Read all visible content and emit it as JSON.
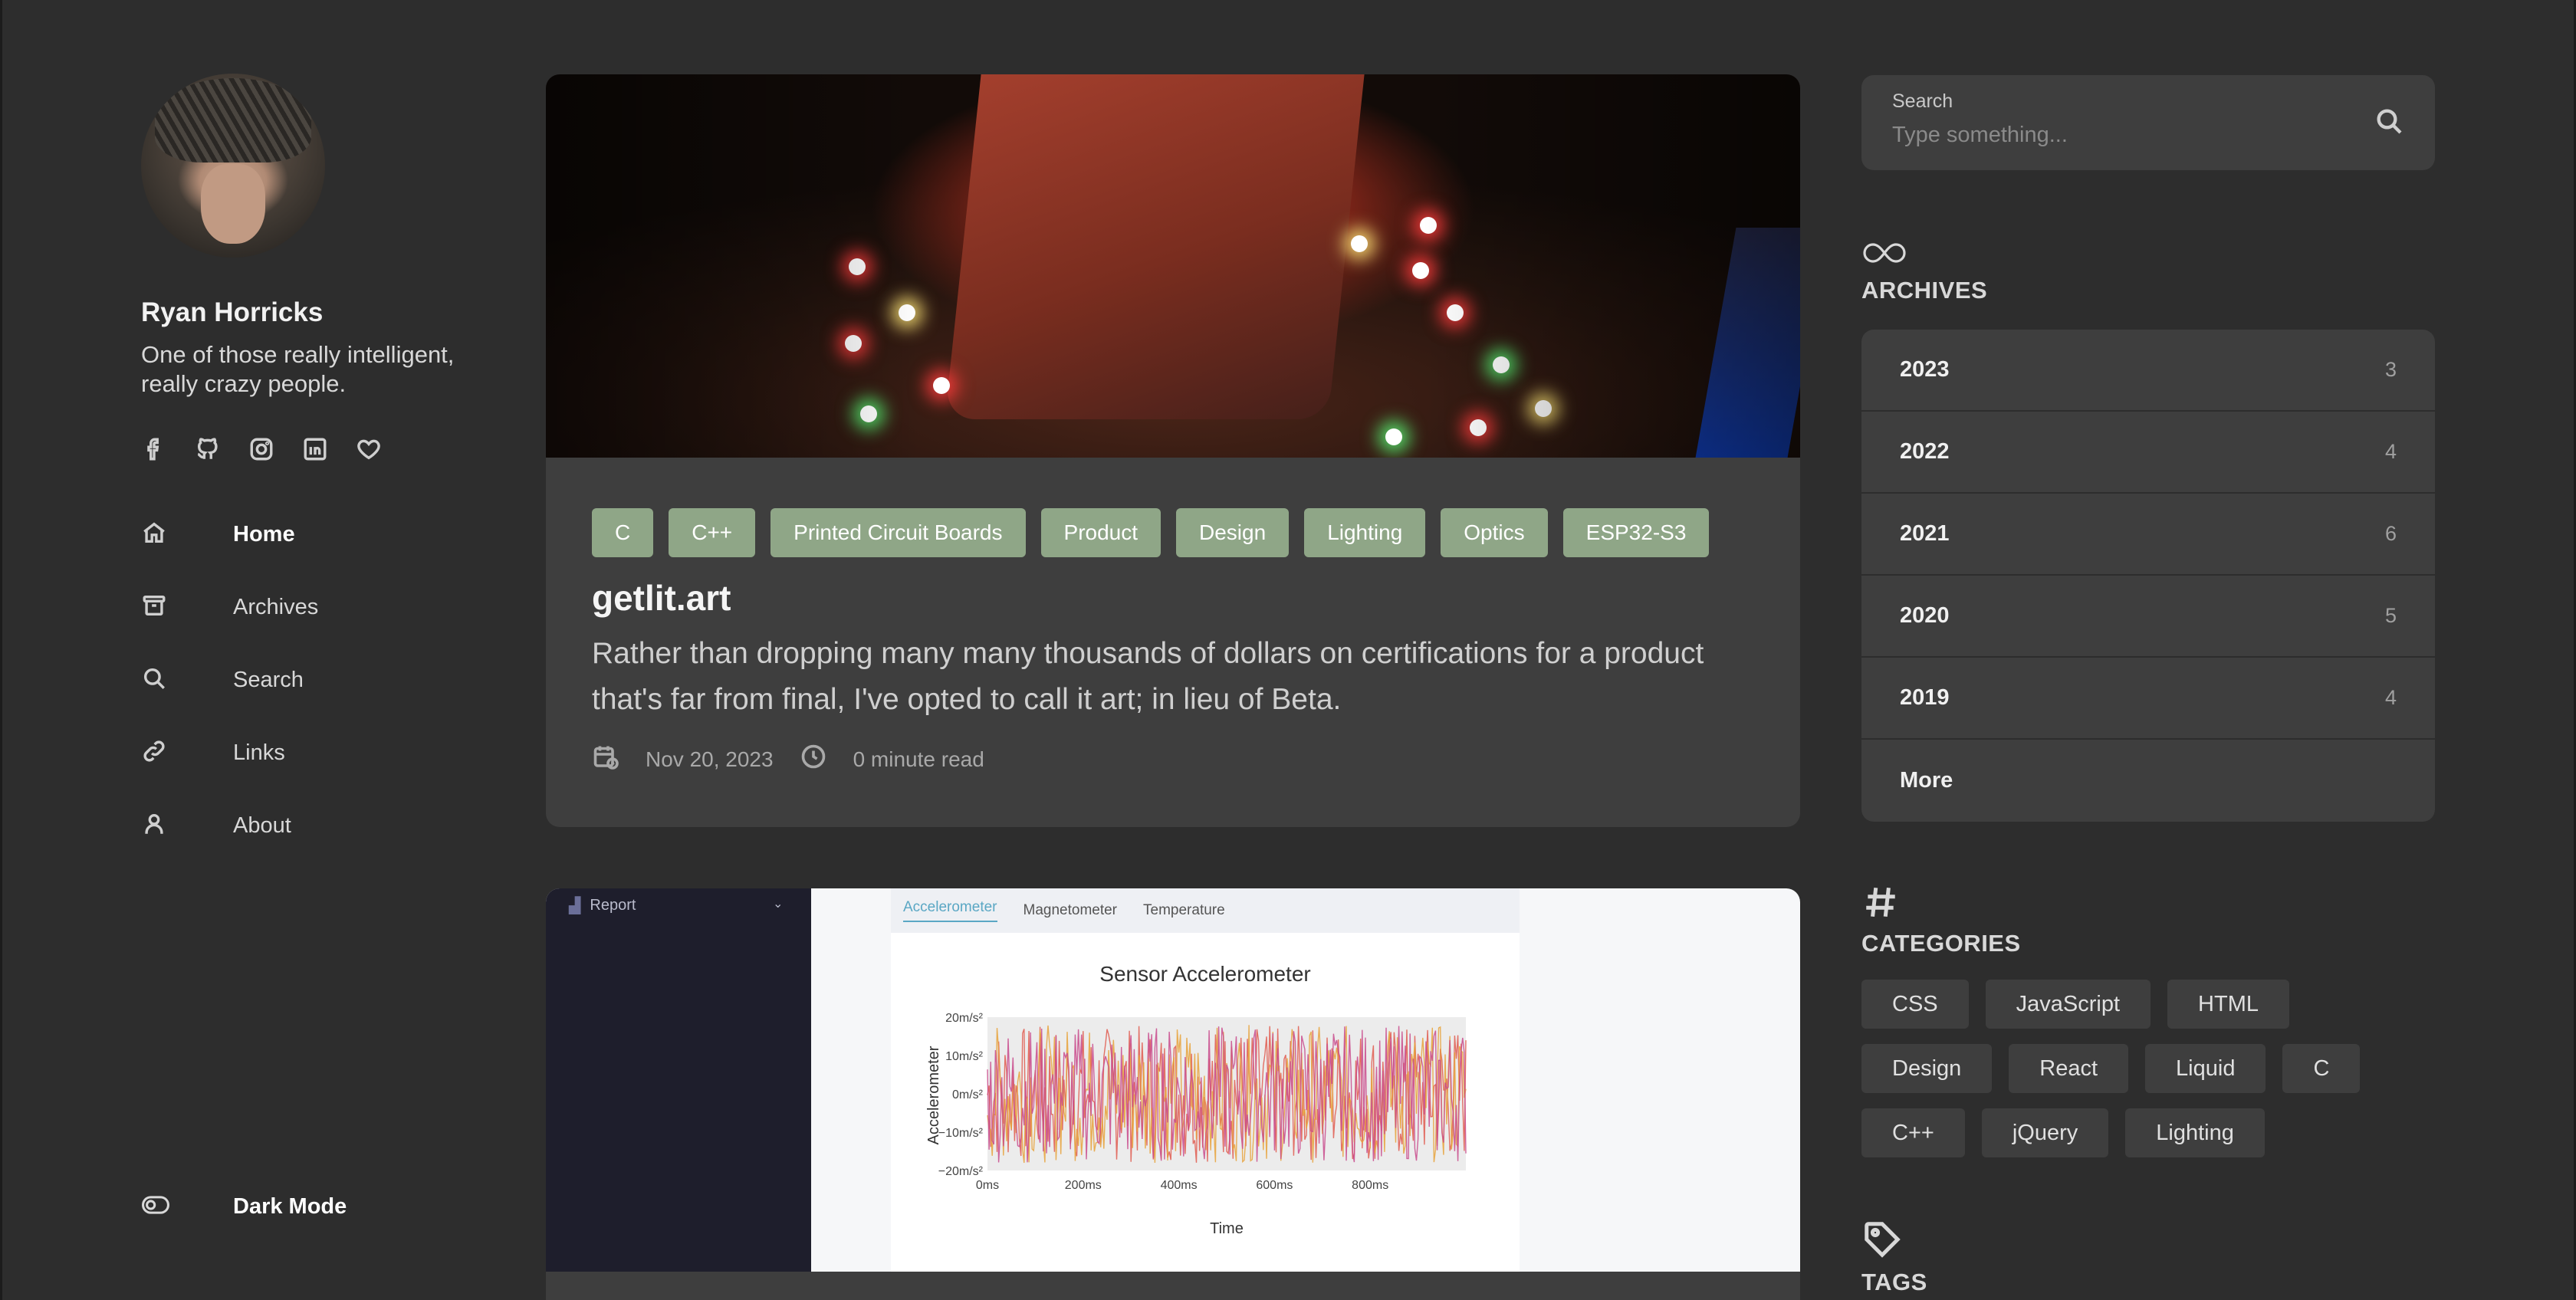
{
  "profile": {
    "name": "Ryan Horricks",
    "bio": "One of those really intelligent, really crazy people."
  },
  "social": [
    {
      "icon": "facebook-icon"
    },
    {
      "icon": "github-icon"
    },
    {
      "icon": "instagram-icon"
    },
    {
      "icon": "linkedin-icon"
    },
    {
      "icon": "heart-icon"
    }
  ],
  "nav": {
    "items": [
      {
        "label": "Home",
        "icon": "home-icon",
        "active": true
      },
      {
        "label": "Archives",
        "icon": "archive-box-icon"
      },
      {
        "label": "Search",
        "icon": "search-icon"
      },
      {
        "label": "Links",
        "icon": "link-icon"
      },
      {
        "label": "About",
        "icon": "user-icon"
      }
    ],
    "dark_mode_label": "Dark Mode"
  },
  "post": {
    "tags": [
      "C",
      "C++",
      "Printed Circuit Boards",
      "Product",
      "Design",
      "Lighting",
      "Optics",
      "ESP32-S3"
    ],
    "title": "getlit.art",
    "excerpt": "Rather than dropping many many thousands of dollars on certifications for a product that's far from final, I've opted to call it art; in lieu of Beta.",
    "date": "Nov 20, 2023",
    "read_time": "0 minute read"
  },
  "post2": {
    "sidebar_label": "Report",
    "tabs": [
      "Accelerometer",
      "Magnetometer",
      "Temperature"
    ],
    "chart_title": "Sensor Accelerometer"
  },
  "chart_data": {
    "type": "line",
    "title": "Sensor Accelerometer",
    "xlabel": "Time",
    "ylabel": "Accelerometer",
    "x_ticks": [
      "0ms",
      "200ms",
      "400ms",
      "600ms",
      "800ms"
    ],
    "y_ticks": [
      "20m/s²",
      "10m/s²",
      "0m/s²",
      "−10m/s²",
      "−20m/s²"
    ],
    "xlim": [
      0,
      1000
    ],
    "ylim": [
      -20,
      20
    ],
    "series_colors": [
      "#e05a4f",
      "#e8a23a",
      "#c94a8c"
    ]
  },
  "search": {
    "label": "Search",
    "placeholder": "Type something..."
  },
  "archives": {
    "title": "ARCHIVES",
    "rows": [
      {
        "year": "2023",
        "count": "3"
      },
      {
        "year": "2022",
        "count": "4"
      },
      {
        "year": "2021",
        "count": "6"
      },
      {
        "year": "2020",
        "count": "5"
      },
      {
        "year": "2019",
        "count": "4"
      }
    ],
    "more_label": "More"
  },
  "categories": {
    "title": "CATEGORIES",
    "items": [
      "CSS",
      "JavaScript",
      "HTML",
      "Design",
      "React",
      "Liquid",
      "C",
      "C++",
      "jQuery",
      "Lighting"
    ]
  },
  "tags_section": {
    "title": "TAGS"
  }
}
